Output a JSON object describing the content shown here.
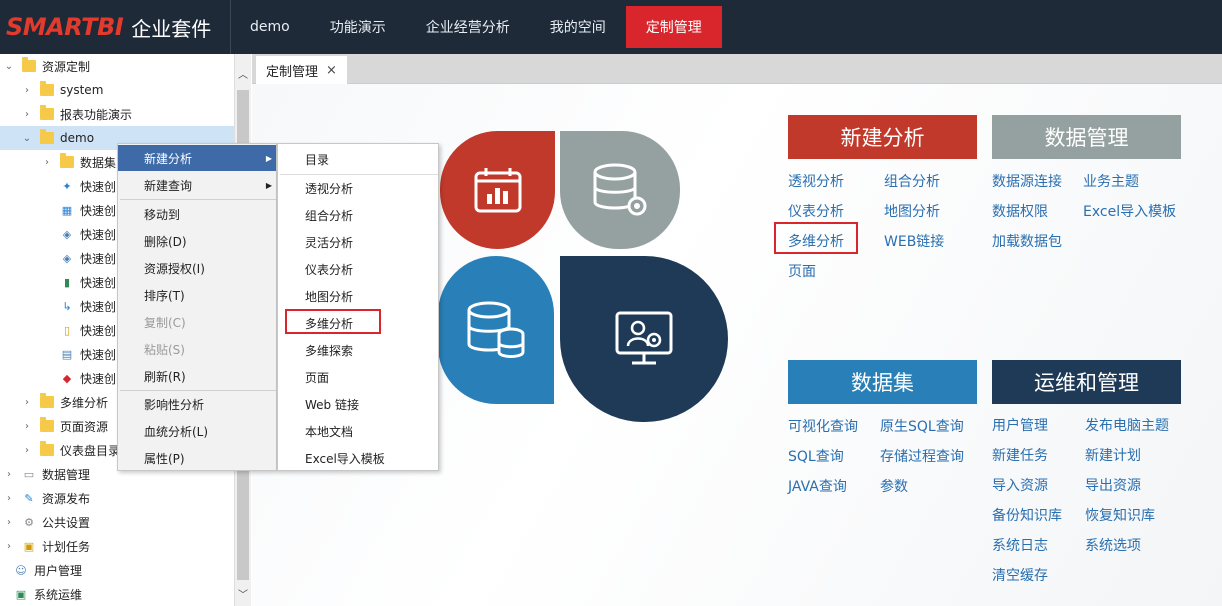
{
  "brand": {
    "logo": "SMARTBI",
    "suite": "企业套件"
  },
  "nav": [
    {
      "label": "demo"
    },
    {
      "label": "功能演示"
    },
    {
      "label": "企业经营分析"
    },
    {
      "label": "我的空间"
    },
    {
      "label": "定制管理"
    }
  ],
  "tree": [
    {
      "label": "资源定制"
    },
    {
      "label": "system"
    },
    {
      "label": "报表功能演示"
    },
    {
      "label": "demo"
    },
    {
      "label": "数据集"
    },
    {
      "label": "快速创"
    },
    {
      "label": "快速创"
    },
    {
      "label": "快速创"
    },
    {
      "label": "快速创"
    },
    {
      "label": "快速创"
    },
    {
      "label": "快速创"
    },
    {
      "label": "快速创"
    },
    {
      "label": "快速创"
    },
    {
      "label": "快速创"
    },
    {
      "label": "多维分析"
    },
    {
      "label": "页面资源"
    },
    {
      "label": "仪表盘目录"
    },
    {
      "label": "数据管理"
    },
    {
      "label": "资源发布"
    },
    {
      "label": "公共设置"
    },
    {
      "label": "计划任务"
    },
    {
      "label": "用户管理"
    },
    {
      "label": "系统运维"
    }
  ],
  "tab": {
    "label": "定制管理",
    "close": "×"
  },
  "menu1": [
    {
      "label": "新建分析"
    },
    {
      "label": "新建查询"
    },
    {
      "label": "移动到"
    },
    {
      "label": "删除(D)"
    },
    {
      "label": "资源授权(I)"
    },
    {
      "label": "排序(T)"
    },
    {
      "label": "复制(C)"
    },
    {
      "label": "粘贴(S)"
    },
    {
      "label": "刷新(R)"
    },
    {
      "label": "影响性分析"
    },
    {
      "label": "血统分析(L)"
    },
    {
      "label": "属性(P)"
    }
  ],
  "menu2": [
    {
      "label": "目录"
    },
    {
      "label": "透视分析"
    },
    {
      "label": "组合分析"
    },
    {
      "label": "灵活分析"
    },
    {
      "label": "仪表分析"
    },
    {
      "label": "地图分析"
    },
    {
      "label": "多维分析"
    },
    {
      "label": "多维探索"
    },
    {
      "label": "页面"
    },
    {
      "label": "Web 链接"
    },
    {
      "label": "本地文档"
    },
    {
      "label": "Excel导入模板"
    }
  ],
  "panels": {
    "new_analysis": {
      "title": "新建分析",
      "links": [
        "透视分析",
        "组合分析",
        "仪表分析",
        "地图分析",
        "多维分析",
        "WEB链接",
        "页面"
      ]
    },
    "data_mgmt": {
      "title": "数据管理",
      "links": [
        "数据源连接",
        "业务主题",
        "数据权限",
        "Excel导入模板",
        "加载数据包"
      ]
    },
    "dataset": {
      "title": "数据集",
      "links": [
        "可视化查询",
        "原生SQL查询",
        "SQL查询",
        "存储过程查询",
        "JAVA查询",
        "参数"
      ]
    },
    "ops": {
      "title": "运维和管理",
      "links": [
        "用户管理",
        "发布电脑主题",
        "新建任务",
        "新建计划",
        "导入资源",
        "导出资源",
        "备份知识库",
        "恢复知识库",
        "系统日志",
        "系统选项",
        "清空缓存"
      ]
    }
  },
  "colors": {
    "topbar": "#1e2a38",
    "nav_active": "#d9262c",
    "red": "#c0392b",
    "gray": "#95a0a0",
    "blue": "#2980b9",
    "navy": "#1e3a57",
    "link": "#2a6fb0"
  }
}
